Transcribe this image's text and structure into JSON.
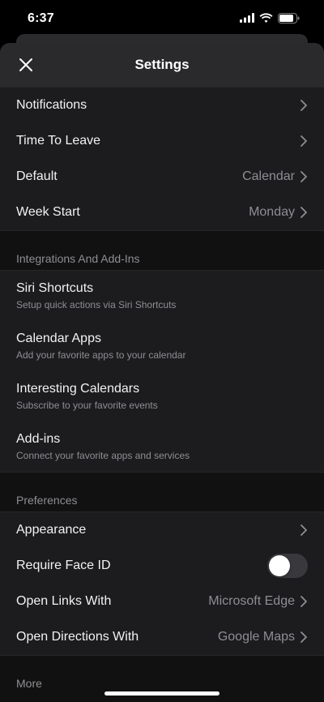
{
  "status_bar": {
    "time": "6:37",
    "icons": [
      "signal-icon",
      "wifi-icon",
      "battery-icon"
    ]
  },
  "header": {
    "title": "Settings",
    "close_icon": "close-icon"
  },
  "general": {
    "items": [
      {
        "label": "Notifications",
        "value": ""
      },
      {
        "label": "Time To Leave",
        "value": ""
      },
      {
        "label": "Default",
        "value": "Calendar"
      },
      {
        "label": "Week Start",
        "value": "Monday"
      }
    ]
  },
  "integrations": {
    "title": "Integrations And Add-Ins",
    "items": [
      {
        "label": "Siri Shortcuts",
        "sub": "Setup quick actions via Siri Shortcuts"
      },
      {
        "label": "Calendar Apps",
        "sub": "Add your favorite apps to your calendar"
      },
      {
        "label": "Interesting Calendars",
        "sub": "Subscribe to your favorite events"
      },
      {
        "label": "Add-ins",
        "sub": "Connect your favorite apps and services"
      }
    ]
  },
  "preferences": {
    "title": "Preferences",
    "items": [
      {
        "label": "Appearance",
        "value": ""
      },
      {
        "label": "Require Face ID",
        "toggle_on": false
      },
      {
        "label": "Open Links With",
        "value": "Microsoft Edge"
      },
      {
        "label": "Open Directions With",
        "value": "Google Maps"
      }
    ]
  },
  "more": {
    "title": "More"
  },
  "colors": {
    "background": "#000000",
    "sheet": "#111111",
    "row": "#1c1c1e",
    "header": "#2a2a2c",
    "secondary_text": "#8e8e93"
  }
}
